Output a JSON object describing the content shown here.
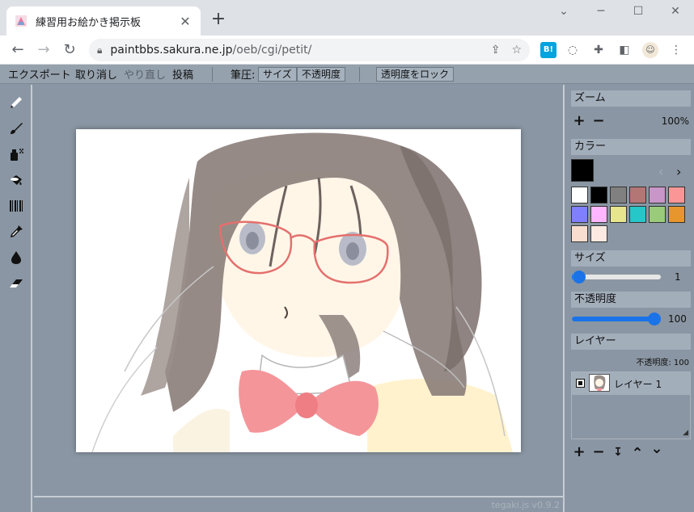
{
  "browser": {
    "tab_title": "練習用お絵かき掲示板",
    "tab_close": "✕",
    "new_tab": "+",
    "win_min": "─",
    "win_max": "☐",
    "win_close": "✕",
    "url_host": "paintbbs.sakura.ne.jp",
    "url_path": "/oeb/cgi/petit/",
    "hatena_label": "B!"
  },
  "toolbar": {
    "export": "エクスポート",
    "undo": "取り消し",
    "redo": "やり直し",
    "post": "投稿",
    "pressure_label": "筆圧:",
    "size_btn": "サイズ",
    "opacity_btn": "不透明度",
    "lock_alpha_btn": "透明度をロック"
  },
  "tools": [
    "pencil-icon",
    "brush-icon",
    "airbrush-icon",
    "bucket-icon",
    "pattern-icon",
    "eyedropper-icon",
    "blur-icon",
    "eraser-icon"
  ],
  "panels": {
    "zoom_header": "ズーム",
    "zoom_in": "+",
    "zoom_out": "−",
    "zoom_value": "100%",
    "color_header": "カラー",
    "current_color": "#000000",
    "palette_prev": "‹",
    "palette_next": "›",
    "palette": [
      "#ffffff",
      "#000000",
      "#808080",
      "#b47575",
      "#c896c8",
      "#fa9696",
      "#8080ff",
      "#ffb6ff",
      "#e7e58d",
      "#25c7c9",
      "#99cb7b",
      "#e7962d",
      "#f9ddcf",
      "#fceae2"
    ],
    "size_header": "サイズ",
    "size_value": "1",
    "size_level": 0.01,
    "opacity_header": "不透明度",
    "opacity_value": "100",
    "opacity_level": 1.0,
    "layer_header": "レイヤー",
    "layer_opacity_label": "不透明度: 100",
    "layers": [
      {
        "name": "レイヤー 1",
        "visible": true
      }
    ],
    "layer_add": "+",
    "layer_remove": "−",
    "layer_merge": "↧",
    "layer_up": "⌃",
    "layer_down": "⌄"
  },
  "status": {
    "version": "tegaki.js v0.9.2"
  },
  "colors": {
    "accent": "#1a73e8",
    "panel_bg": "#8a96a3"
  }
}
